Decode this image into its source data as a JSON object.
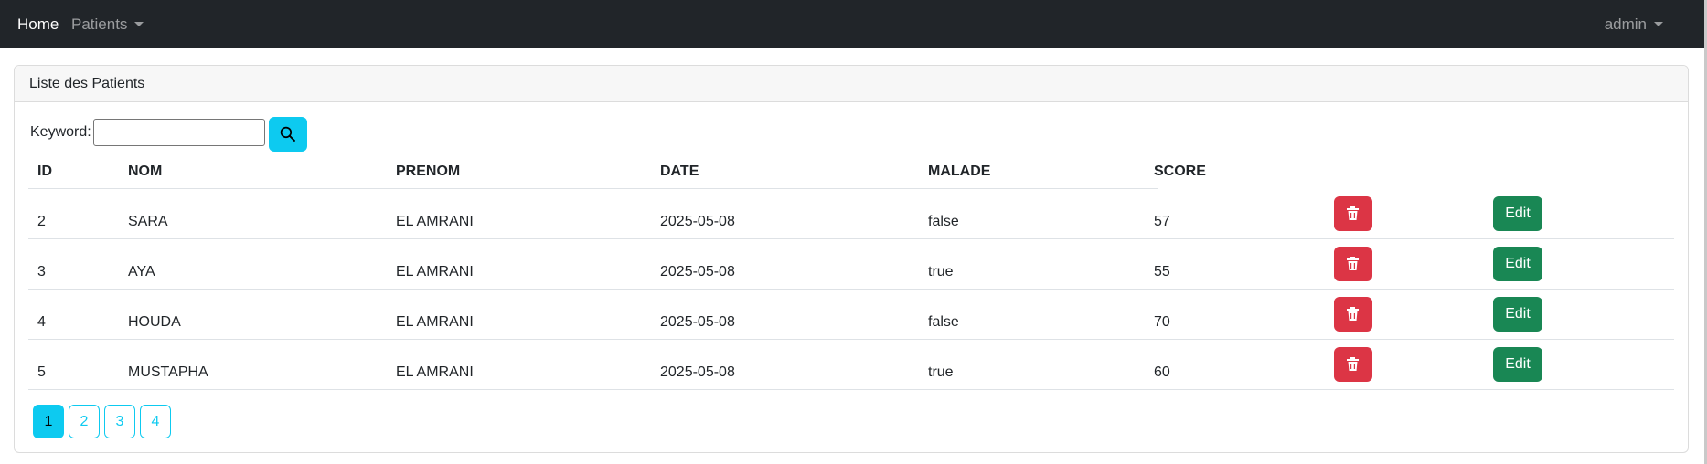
{
  "navbar": {
    "home": "Home",
    "patients": "Patients",
    "user": "admin"
  },
  "card": {
    "title": "Liste des Patients"
  },
  "search": {
    "label": "Keyword:",
    "value": "",
    "placeholder": "",
    "icon": "search-icon"
  },
  "table": {
    "columns": [
      "ID",
      "NOM",
      "PRENOM",
      "DATE",
      "MALADE",
      "SCORE"
    ],
    "rows": [
      {
        "id": "2",
        "nom": "SARA",
        "prenom": "EL AMRANI",
        "date": "2025-05-08",
        "malade": "false",
        "score": "57"
      },
      {
        "id": "3",
        "nom": "AYA",
        "prenom": "EL AMRANI",
        "date": "2025-05-08",
        "malade": "true",
        "score": "55"
      },
      {
        "id": "4",
        "nom": "HOUDA",
        "prenom": "EL AMRANI",
        "date": "2025-05-08",
        "malade": "false",
        "score": "70"
      },
      {
        "id": "5",
        "nom": "MUSTAPHA",
        "prenom": "EL AMRANI",
        "date": "2025-05-08",
        "malade": "true",
        "score": "60"
      }
    ],
    "delete_icon": "trash-icon",
    "edit_label": "Edit"
  },
  "pagination": {
    "pages": [
      "1",
      "2",
      "3",
      "4"
    ],
    "current": "1"
  },
  "colors": {
    "navbar": "#212529",
    "info": "#0dcaf0",
    "danger": "#dc3545",
    "success": "#198754"
  }
}
